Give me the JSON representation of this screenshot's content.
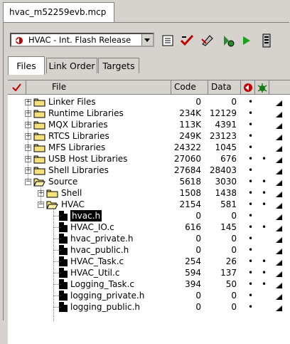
{
  "window": {
    "tab_title": "hvac_m52259evb.mcp"
  },
  "toolbar": {
    "target": "HVAC - Int. Flash Release",
    "buttons": [
      "settings-icon",
      "check-icon",
      "make-icon",
      "debug-icon",
      "run-icon",
      "project-icon"
    ]
  },
  "tabs": [
    "Files",
    "Link Order",
    "Targets"
  ],
  "columns": {
    "file": "File",
    "code": "Code",
    "data": "Data"
  },
  "rows": [
    {
      "level": 0,
      "kind": "folder",
      "name": "Linker Files",
      "code": "0",
      "data": "0",
      "dot1": "•",
      "dot2": "",
      "expander": "+"
    },
    {
      "level": 0,
      "kind": "folder",
      "name": "Runtime Libraries",
      "code": "234K",
      "data": "12129",
      "dot1": "•",
      "dot2": "",
      "expander": "+"
    },
    {
      "level": 0,
      "kind": "folder",
      "name": "MQX Libraries",
      "code": "113K",
      "data": "4391",
      "dot1": "•",
      "dot2": "",
      "expander": "+"
    },
    {
      "level": 0,
      "kind": "folder",
      "name": "RTCS Libraries",
      "code": "249K",
      "data": "23123",
      "dot1": "•",
      "dot2": "",
      "expander": "+"
    },
    {
      "level": 0,
      "kind": "folder",
      "name": "MFS Libraries",
      "code": "24322",
      "data": "1045",
      "dot1": "•",
      "dot2": "",
      "expander": "+"
    },
    {
      "level": 0,
      "kind": "folder",
      "name": "USB Host Libraries",
      "code": "27060",
      "data": "676",
      "dot1": "•",
      "dot2": "•",
      "expander": "+"
    },
    {
      "level": 0,
      "kind": "folder",
      "name": "Shell Libraries",
      "code": "27684",
      "data": "28403",
      "dot1": "•",
      "dot2": "",
      "expander": "+"
    },
    {
      "level": 0,
      "kind": "folder",
      "name": "Source",
      "code": "5618",
      "data": "3030",
      "dot1": "•",
      "dot2": "•",
      "expander": "−"
    },
    {
      "level": 1,
      "kind": "folder",
      "name": "Shell",
      "code": "1508",
      "data": "1438",
      "dot1": "•",
      "dot2": "•",
      "expander": "+"
    },
    {
      "level": 1,
      "kind": "folder",
      "name": "HVAC",
      "code": "2154",
      "data": "581",
      "dot1": "•",
      "dot2": "•",
      "expander": "−"
    },
    {
      "level": 2,
      "kind": "file",
      "name": "hvac.h",
      "code": "0",
      "data": "0",
      "dot1": "•",
      "dot2": "",
      "selected": true
    },
    {
      "level": 2,
      "kind": "file",
      "name": "HVAC_IO.c",
      "code": "616",
      "data": "145",
      "dot1": "•",
      "dot2": "•"
    },
    {
      "level": 2,
      "kind": "file",
      "name": "hvac_private.h",
      "code": "0",
      "data": "0",
      "dot1": "•",
      "dot2": ""
    },
    {
      "level": 2,
      "kind": "file",
      "name": "hvac_public.h",
      "code": "0",
      "data": "0",
      "dot1": "•",
      "dot2": ""
    },
    {
      "level": 2,
      "kind": "file",
      "name": "HVAC_Task.c",
      "code": "254",
      "data": "26",
      "dot1": "•",
      "dot2": "•"
    },
    {
      "level": 2,
      "kind": "file",
      "name": "HVAC_Util.c",
      "code": "594",
      "data": "137",
      "dot1": "•",
      "dot2": "•"
    },
    {
      "level": 2,
      "kind": "file",
      "name": "Logging_Task.c",
      "code": "394",
      "data": "50",
      "dot1": "•",
      "dot2": "•"
    },
    {
      "level": 2,
      "kind": "file",
      "name": "logging_private.h",
      "code": "0",
      "data": "0",
      "dot1": "•",
      "dot2": ""
    },
    {
      "level": 2,
      "kind": "file",
      "name": "logging_public.h",
      "code": "0",
      "data": "0",
      "dot1": "•",
      "dot2": ""
    }
  ]
}
